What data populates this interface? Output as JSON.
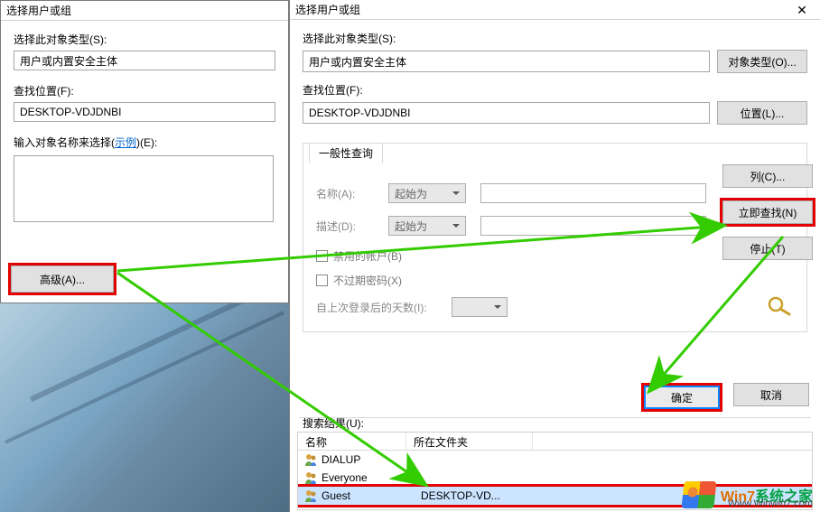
{
  "leftDialog": {
    "title": "选择用户或组",
    "objTypeLabel": "选择此对象类型(S):",
    "objTypeValue": "用户或内置安全主体",
    "locLabel": "查找位置(F):",
    "locValue": "DESKTOP-VDJDNBI",
    "namesLabel_pre": "输入对象名称来选择(",
    "namesLabel_link": "示例",
    "namesLabel_post": ")(E):",
    "advancedBtn": "高级(A)..."
  },
  "rightDialog": {
    "title": "选择用户或组",
    "objTypeLabel": "选择此对象类型(S):",
    "objTypeValue": "用户或内置安全主体",
    "objTypeBtn": "对象类型(O)...",
    "locLabel": "查找位置(F):",
    "locValue": "DESKTOP-VDJDNBI",
    "locBtn": "位置(L)...",
    "fsTab": "一般性查询",
    "nameLabel": "名称(A):",
    "nameMode": "起始为",
    "descLabel": "描述(D):",
    "descMode": "起始为",
    "disabledCb": "禁用的帐户(B)",
    "neverExpireCb": "不过期密码(X)",
    "daysLabel": "自上次登录后的天数(I):",
    "colBtn": "列(C)...",
    "findNowBtn": "立即查找(N)",
    "stopBtn": "停止(T)",
    "okBtn": "确定",
    "cancelBtn": "取消",
    "srLabel": "搜索结果(U):",
    "gridHeaders": {
      "name": "名称",
      "folder": "所在文件夹"
    },
    "rows": [
      {
        "name": "DIALUP",
        "folder": ""
      },
      {
        "name": "Everyone",
        "folder": ""
      },
      {
        "name": "Guest",
        "folder": "DESKTOP-VD..."
      }
    ],
    "selectedRowIndex": 2
  },
  "watermark": {
    "brand_prefix": "Win7",
    "brand_suffix": "系统之家",
    "url": "Www.Winwin7.com"
  }
}
